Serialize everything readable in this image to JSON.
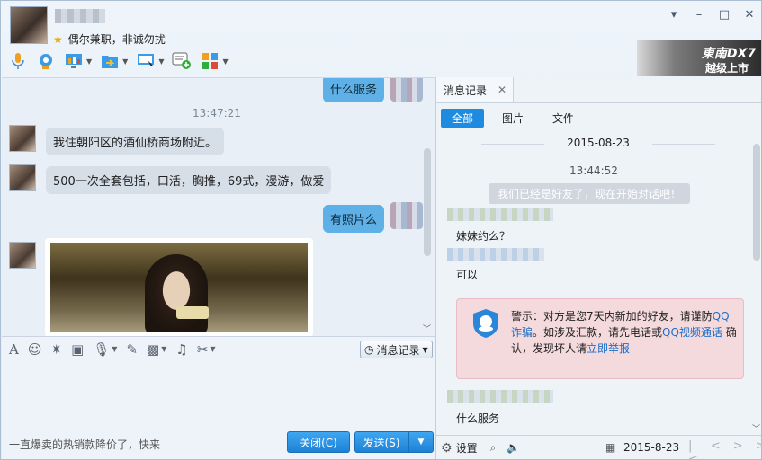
{
  "header": {
    "status_text": "偶尔兼职，非诚勿扰",
    "ad_line1": "東南DX7",
    "ad_line2": "越级上市"
  },
  "window_controls": [
    "▾",
    "–",
    "□",
    "✕"
  ],
  "toolbar_icons": [
    "microphone-icon",
    "video-call-icon",
    "remote-desktop-icon",
    "file-transfer-icon",
    "screen-share-icon",
    "add-contact-icon",
    "apps-icon"
  ],
  "chat": {
    "top_partial_me": "什么服务",
    "timestamp": "13:47:21",
    "messages": [
      {
        "from": "friend",
        "text": "我住朝阳区的酒仙桥商场附近。"
      },
      {
        "from": "friend",
        "text": "500一次全套包括，口活，胸推，69式，漫游，做爱"
      },
      {
        "from": "me",
        "text": "有照片么"
      }
    ]
  },
  "input_toolbar": {
    "history_label": "消息记录"
  },
  "input": {
    "ad_text": "一直爆卖的热销款降价了，快来",
    "close_label": "关闭(C)",
    "send_label": "发送(S)"
  },
  "history_panel": {
    "tab_label": "消息记录",
    "filters": [
      "全部",
      "图片",
      "文件"
    ],
    "date": "2015-08-23",
    "time": "13:44:52",
    "system_message": "我们已经是好友了，现在开始对话吧！",
    "msg1": "妹妹约么？",
    "msg2": "可以",
    "warning": {
      "prefix": "警示：对方是您7天内新加的好友，请谨防",
      "link1": "QQ诈骗",
      "middle": "。如涉及汇款，请先电话或",
      "link2": "QQ视频通话",
      "confirm": "确认，发现坏人请",
      "link3": "立即举报"
    },
    "msg3": "什么服务",
    "bottom_settings": "设置",
    "bottom_date": "2015-8-23"
  }
}
